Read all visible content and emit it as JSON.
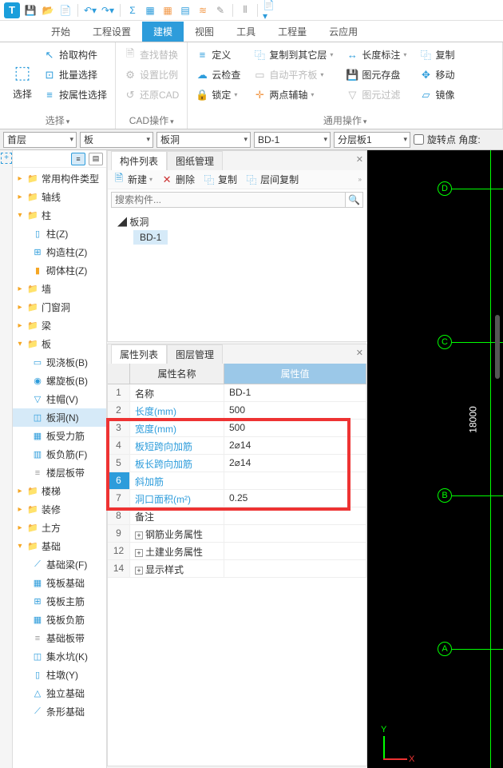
{
  "app_icon": "T",
  "ribbon": {
    "tabs": [
      "开始",
      "工程设置",
      "建模",
      "视图",
      "工具",
      "工程量",
      "云应用"
    ],
    "active_tab": 2,
    "select_group": {
      "big": "选择",
      "items": [
        "拾取构件",
        "批量选择",
        "按属性选择"
      ],
      "label": "选择"
    },
    "cad_group": {
      "items": [
        "查找替换",
        "设置比例",
        "还原CAD"
      ],
      "label": "CAD操作"
    },
    "general_group": {
      "col1": [
        "定义",
        "云检查",
        "锁定"
      ],
      "col2": [
        "复制到其它层",
        "自动平齐板",
        "两点辅轴"
      ],
      "col3": [
        "长度标注",
        "图元存盘",
        "图元过滤"
      ],
      "col4": [
        "复制",
        "移动",
        "镜像"
      ],
      "label": "通用操作"
    }
  },
  "filters": [
    "首层",
    "板",
    "板洞",
    "BD-1",
    "分层板1"
  ],
  "rotate_label": "旋转点 角度:",
  "tree": {
    "groups": [
      {
        "label": "常用构件类型",
        "open": false
      },
      {
        "label": "轴线",
        "open": false
      },
      {
        "label": "柱",
        "open": true,
        "children": [
          {
            "label": "柱(Z)",
            "icon": "▯",
            "color": "#2d9cdb"
          },
          {
            "label": "构造柱(Z)",
            "icon": "⊞",
            "color": "#2d9cdb"
          },
          {
            "label": "砌体柱(Z)",
            "icon": "▮",
            "color": "#f5a623"
          }
        ]
      },
      {
        "label": "墙",
        "open": false
      },
      {
        "label": "门窗洞",
        "open": false
      },
      {
        "label": "梁",
        "open": false
      },
      {
        "label": "板",
        "open": true,
        "children": [
          {
            "label": "现浇板(B)",
            "icon": "▭",
            "color": "#2d9cdb"
          },
          {
            "label": "螺旋板(B)",
            "icon": "◉",
            "color": "#2d9cdb"
          },
          {
            "label": "柱帽(V)",
            "icon": "▽",
            "color": "#2d9cdb"
          },
          {
            "label": "板洞(N)",
            "icon": "◫",
            "color": "#2d9cdb",
            "selected": true
          },
          {
            "label": "板受力筋",
            "icon": "▦",
            "color": "#2d9cdb"
          },
          {
            "label": "板负筋(F)",
            "icon": "▥",
            "color": "#2d9cdb"
          },
          {
            "label": "楼层板带",
            "icon": "≡",
            "color": "#999"
          }
        ]
      },
      {
        "label": "楼梯",
        "open": false
      },
      {
        "label": "装修",
        "open": false
      },
      {
        "label": "土方",
        "open": false
      },
      {
        "label": "基础",
        "open": true,
        "children": [
          {
            "label": "基础梁(F)",
            "icon": "⟋",
            "color": "#2d9cdb"
          },
          {
            "label": "筏板基础",
            "icon": "▦",
            "color": "#2d9cdb"
          },
          {
            "label": "筏板主筋",
            "icon": "⊞",
            "color": "#2d9cdb"
          },
          {
            "label": "筏板负筋",
            "icon": "▦",
            "color": "#2d9cdb"
          },
          {
            "label": "基础板带",
            "icon": "≡",
            "color": "#999"
          },
          {
            "label": "集水坑(K)",
            "icon": "◫",
            "color": "#2d9cdb"
          },
          {
            "label": "柱墩(Y)",
            "icon": "▯",
            "color": "#2d9cdb"
          },
          {
            "label": "独立基础",
            "icon": "△",
            "color": "#2d9cdb"
          },
          {
            "label": "条形基础",
            "icon": "⟋",
            "color": "#2d9cdb"
          }
        ]
      }
    ]
  },
  "comp_panel": {
    "tabs": [
      "构件列表",
      "图纸管理"
    ],
    "toolbar": [
      "新建",
      "删除",
      "复制",
      "层间复制"
    ],
    "search_ph": "搜索构件...",
    "root": "板洞",
    "item": "BD-1"
  },
  "prop_panel": {
    "tabs": [
      "属性列表",
      "图层管理"
    ],
    "head": [
      "",
      "属性名称",
      "属性值"
    ],
    "rows": [
      {
        "n": "1",
        "name": "名称",
        "val": "BD-1",
        "blue": false
      },
      {
        "n": "2",
        "name": "长度(mm)",
        "val": "500",
        "blue": true
      },
      {
        "n": "3",
        "name": "宽度(mm)",
        "val": "500",
        "blue": true
      },
      {
        "n": "4",
        "name": "板短跨向加筋",
        "val": "2⌀14",
        "blue": true
      },
      {
        "n": "5",
        "name": "板长跨向加筋",
        "val": "2⌀14",
        "blue": true
      },
      {
        "n": "6",
        "name": "斜加筋",
        "val": "",
        "blue": true,
        "sel": true
      },
      {
        "n": "7",
        "name": "洞口面积(m²)",
        "val": "0.25",
        "blue": true
      },
      {
        "n": "8",
        "name": "备注",
        "val": "",
        "blue": false
      },
      {
        "n": "9",
        "name": "钢筋业务属性",
        "val": "",
        "blue": false,
        "exp": true
      },
      {
        "n": "12",
        "name": "土建业务属性",
        "val": "",
        "blue": false,
        "exp": true
      },
      {
        "n": "14",
        "name": "显示样式",
        "val": "",
        "blue": false,
        "exp": true
      }
    ]
  },
  "viewport": {
    "labels": [
      "D",
      "C",
      "B",
      "A"
    ],
    "dim": "18000",
    "y": "Y",
    "x": "X"
  }
}
